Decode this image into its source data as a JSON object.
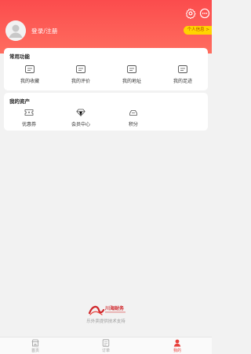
{
  "header": {
    "login_label": "登录/注册",
    "badge_label": "个人信息 >",
    "icons": [
      "settings-icon",
      "message-icon"
    ],
    "background": "#fb4c4d"
  },
  "common_functions": {
    "title": "常用功能",
    "items": [
      {
        "label": "我的收藏",
        "icon": "favorites-icon"
      },
      {
        "label": "我的评价",
        "icon": "reviews-icon"
      },
      {
        "label": "我的地址",
        "icon": "address-icon"
      },
      {
        "label": "我的足迹",
        "icon": "footprint-icon"
      }
    ]
  },
  "my_assets": {
    "title": "我的资产",
    "items": [
      {
        "label": "优惠券",
        "icon": "coupon-icon"
      },
      {
        "label": "会员中心",
        "icon": "diamond-icon"
      },
      {
        "label": "积分",
        "icon": "points-icon"
      }
    ]
  },
  "footer": {
    "brand_text": "川海财务",
    "support_text": "乐外卖提供技术支持"
  },
  "tabbar": {
    "items": [
      {
        "label": "首页",
        "icon": "store-icon",
        "active": false
      },
      {
        "label": "订单",
        "icon": "order-icon",
        "active": false
      },
      {
        "label": "我的",
        "icon": "user-icon",
        "active": true
      }
    ],
    "active_color": "#e8413c",
    "inactive_color": "#999999"
  }
}
